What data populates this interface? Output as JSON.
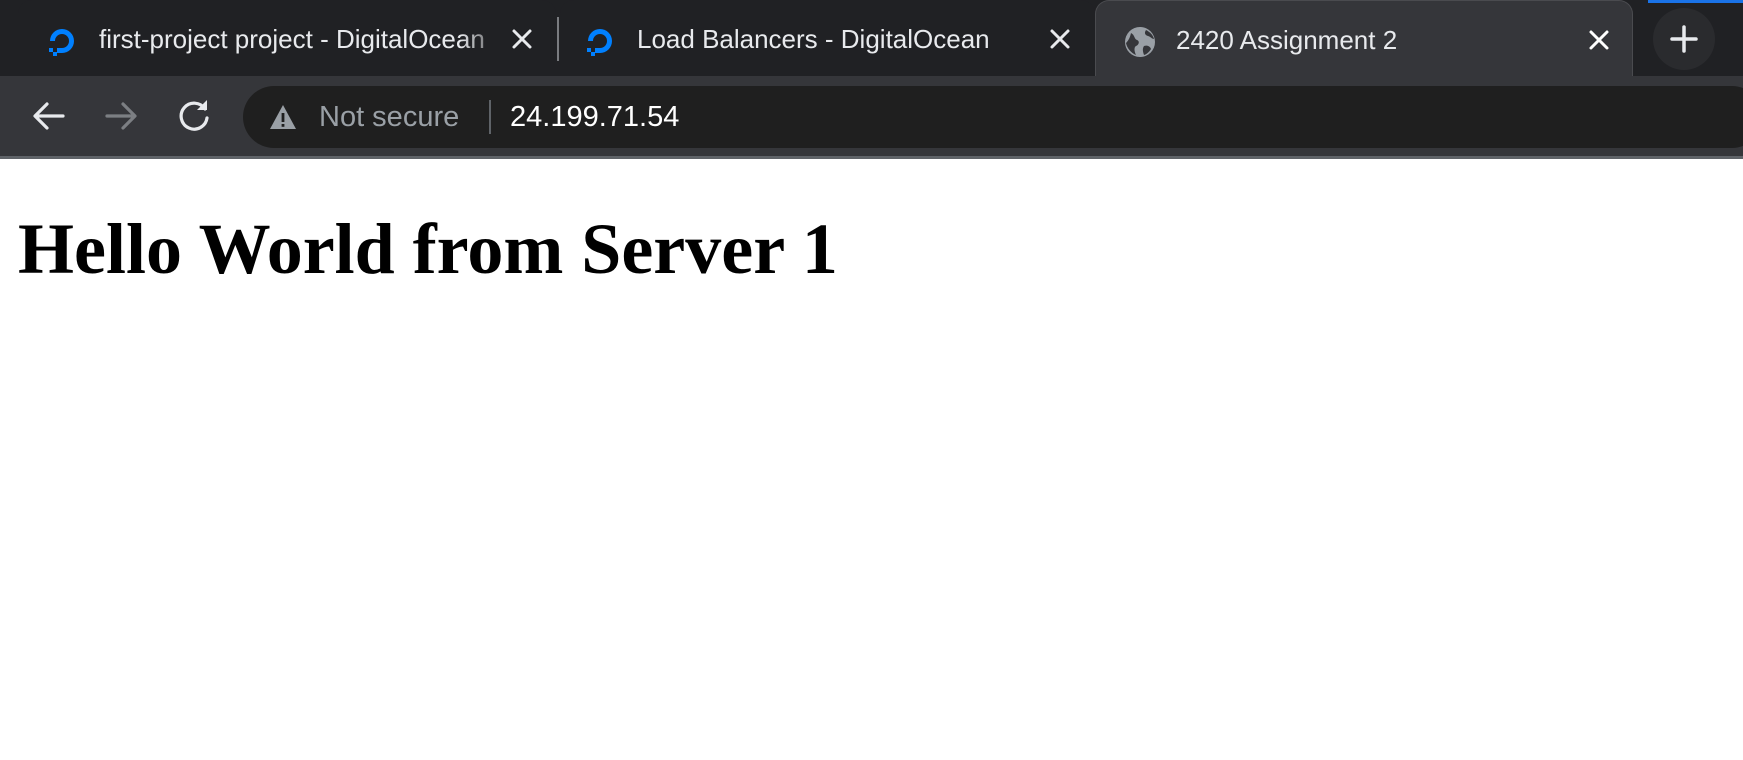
{
  "browser": {
    "tabs": [
      {
        "title": "first-project project - DigitalOcean",
        "favicon": "digitalocean-icon",
        "active": false
      },
      {
        "title": "Load Balancers - DigitalOcean",
        "favicon": "digitalocean-icon",
        "active": false
      },
      {
        "title": "2420 Assignment 2",
        "favicon": "globe-icon",
        "active": true
      }
    ],
    "address_bar": {
      "security_label": "Not secure",
      "url": "24.199.71.54"
    },
    "colors": {
      "digitalocean_brand": "#0080ff",
      "accent": "#1a73e8"
    }
  },
  "page": {
    "heading": "Hello World from Server 1"
  }
}
